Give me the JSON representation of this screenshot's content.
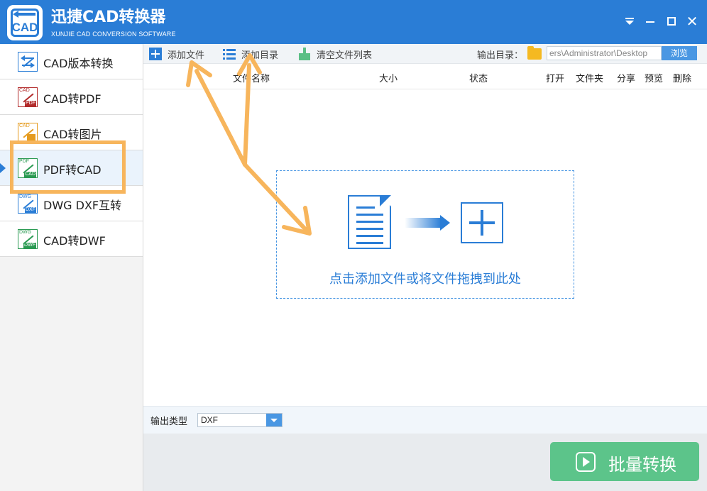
{
  "app": {
    "title": "迅捷CAD转换器",
    "subtitle": "XUNJIE CAD CONVERSION SOFTWARE",
    "logo_text": "CAD",
    "accent_color": "#2a7dd6"
  },
  "window_controls": [
    "menu-icon",
    "minimize-icon",
    "maximize-icon",
    "close-icon"
  ],
  "sidebar": {
    "active_index": 3,
    "items": [
      {
        "label": "CAD版本转换",
        "icon": "cad-version-icon"
      },
      {
        "label": "CAD转PDF",
        "icon": "cad-to-pdf-icon",
        "icon_top": "CAD",
        "icon_bottom": "PDF"
      },
      {
        "label": "CAD转图片",
        "icon": "cad-to-image-icon",
        "icon_top": "CAD"
      },
      {
        "label": "PDF转CAD",
        "icon": "pdf-to-cad-icon",
        "icon_top": "PDF",
        "icon_bottom": "CAD"
      },
      {
        "label": "DWG DXF互转",
        "icon": "dwg-dxf-icon",
        "icon_top": "DWG",
        "icon_bottom": "DXF"
      },
      {
        "label": "CAD转DWF",
        "icon": "cad-to-dwf-icon",
        "icon_top": "DWG",
        "icon_bottom": "DWF"
      }
    ]
  },
  "toolbar": {
    "add_file": "添加文件",
    "add_folder": "添加目录",
    "clear_list": "清空文件列表",
    "output_dir_label": "输出目录：",
    "output_dir_value": "ers\\Administrator\\Desktop",
    "browse": "浏览"
  },
  "table": {
    "columns": [
      "文件名称",
      "大小",
      "状态",
      "打开",
      "文件夹",
      "分享",
      "预览",
      "删除"
    ]
  },
  "dropzone": {
    "hint": "点击添加文件或将文件拖拽到此处"
  },
  "output": {
    "type_label": "输出类型",
    "type_value": "DXF"
  },
  "convert_button": "批量转换"
}
